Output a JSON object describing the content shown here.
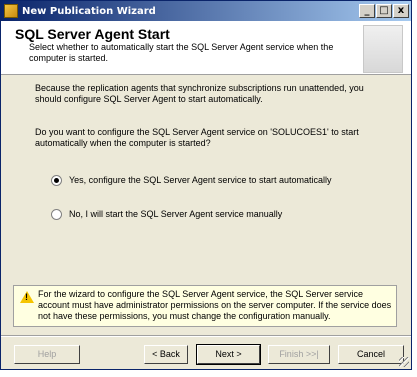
{
  "window": {
    "title": "New Publication Wizard",
    "minimize": "_",
    "maximize": "□",
    "close": "x"
  },
  "header": {
    "title": "SQL Server Agent Start",
    "subtitle": "Select whether to automatically start the SQL Server Agent service when the computer is started."
  },
  "content": {
    "paragraph1": "Because the replication agents that synchronize subscriptions run unattended, you should configure SQL Server Agent to start automatically.",
    "question": "Do you want to configure the SQL Server Agent service on 'SOLUCOES1' to start automatically when the computer is started?",
    "options": [
      {
        "label": "Yes, configure the SQL Server Agent service to start automatically",
        "selected": true
      },
      {
        "label": "No, I will start the SQL Server Agent service manually",
        "selected": false
      }
    ],
    "warning": "For the wizard to configure the SQL Server Agent service, the SQL Server service account must have administrator permissions on the server computer. If the service does not have these permissions, you must change the configuration manually.",
    "warning_icon": "warning-icon"
  },
  "buttons": {
    "help": "Help",
    "back": "< Back",
    "next": "Next >",
    "finish": "Finish >>|",
    "cancel": "Cancel"
  }
}
